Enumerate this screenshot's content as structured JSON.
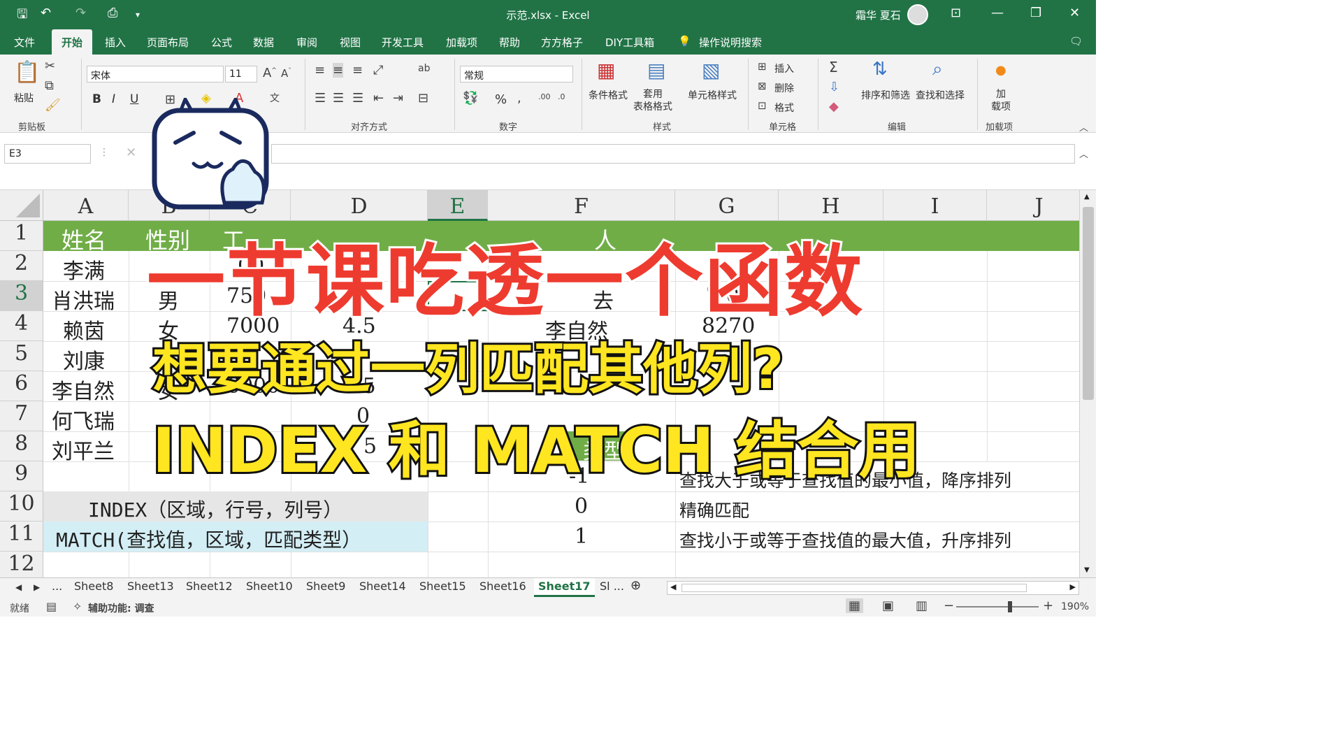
{
  "window": {
    "title": "示范.xlsx  -  Excel",
    "user": "霜华 夏石"
  },
  "menu": [
    "文件",
    "开始",
    "插入",
    "页面布局",
    "公式",
    "数据",
    "审阅",
    "视图",
    "开发工具",
    "加载项",
    "帮助",
    "方方格子",
    "DIY工具箱",
    "操作说明搜索"
  ],
  "ribbon": {
    "paste": "粘贴",
    "font_name": "宋体",
    "font_size": "11",
    "bold": "B",
    "italic": "I",
    "underline": "U",
    "number_format": "常规",
    "percent": "%",
    "cond_format": "条件格式",
    "table_format": "套用\n表格格式",
    "cell_style": "单元格样式",
    "insert": "插入",
    "delete": "删除",
    "format": "格式",
    "sort_filter": "排序和筛选",
    "find_select": "查找和选择",
    "addins": "加\n载项",
    "groups": {
      "clipboard": "剪贴板",
      "align": "对齐方式",
      "number": "数字",
      "styles": "样式",
      "cells": "单元格",
      "edit": "编辑",
      "addins": "加载项"
    }
  },
  "formula_bar": {
    "name_box": "E3"
  },
  "grid": {
    "columns": [
      "A",
      "B",
      "C",
      "D",
      "E",
      "F",
      "G",
      "H",
      "I",
      "J"
    ],
    "rows": [
      "1",
      "2",
      "3",
      "4",
      "5",
      "6",
      "7",
      "8",
      "9",
      "10",
      "11",
      "12"
    ],
    "header_row": {
      "a": "姓名",
      "b": "性别",
      "c": "工",
      "f": "人"
    },
    "cells": {
      "a2": "李满",
      "c2": "00",
      "a3": "肖洪瑞",
      "b3": "男",
      "c3": "750",
      "f3": "去",
      "g3": "7 0",
      "a4": "赖茵",
      "b4": "女",
      "c4": "7000",
      "d4": "4.5",
      "f4": "李自然",
      "g4": "8270",
      "a5": "刘康",
      "a6": "李自然",
      "b6": "女",
      "c6": "6000",
      "d6": "5.5",
      "a7": "何飞瑞",
      "d7": "0",
      "a8": "刘平兰",
      "d8": "5",
      "f8": "类型",
      "f9": "-1",
      "g9": "查找大于或等于查找值的最小值，降序排列",
      "ab10": "INDEX（区域，行号，列号）",
      "f10": "0",
      "g10": "精确匹配",
      "ab11": "MATCH(查找值，区域，匹配类型）",
      "f11": "1",
      "g11": "查找小于或等于查找值的最大值，升序排列"
    }
  },
  "overlay": {
    "line1": "一节课吃透一个函数",
    "line2": "想要通过一列匹配其他列?",
    "line3": "INDEX 和 MATCH 结合用"
  },
  "sheets": [
    "Sheet8",
    "Sheet13",
    "Sheet12",
    "Sheet10",
    "Sheet9",
    "Sheet14",
    "Sheet15",
    "Sheet16",
    "Sheet17",
    "Sl ..."
  ],
  "status": {
    "ready": "就绪",
    "accessibility": "辅助功能: 调查",
    "zoom": "190%"
  },
  "colors": {
    "excel_green": "#217346",
    "header_green": "#70ad47",
    "overlay_red": "#ee3b2f",
    "overlay_yellow": "#ffe620"
  }
}
